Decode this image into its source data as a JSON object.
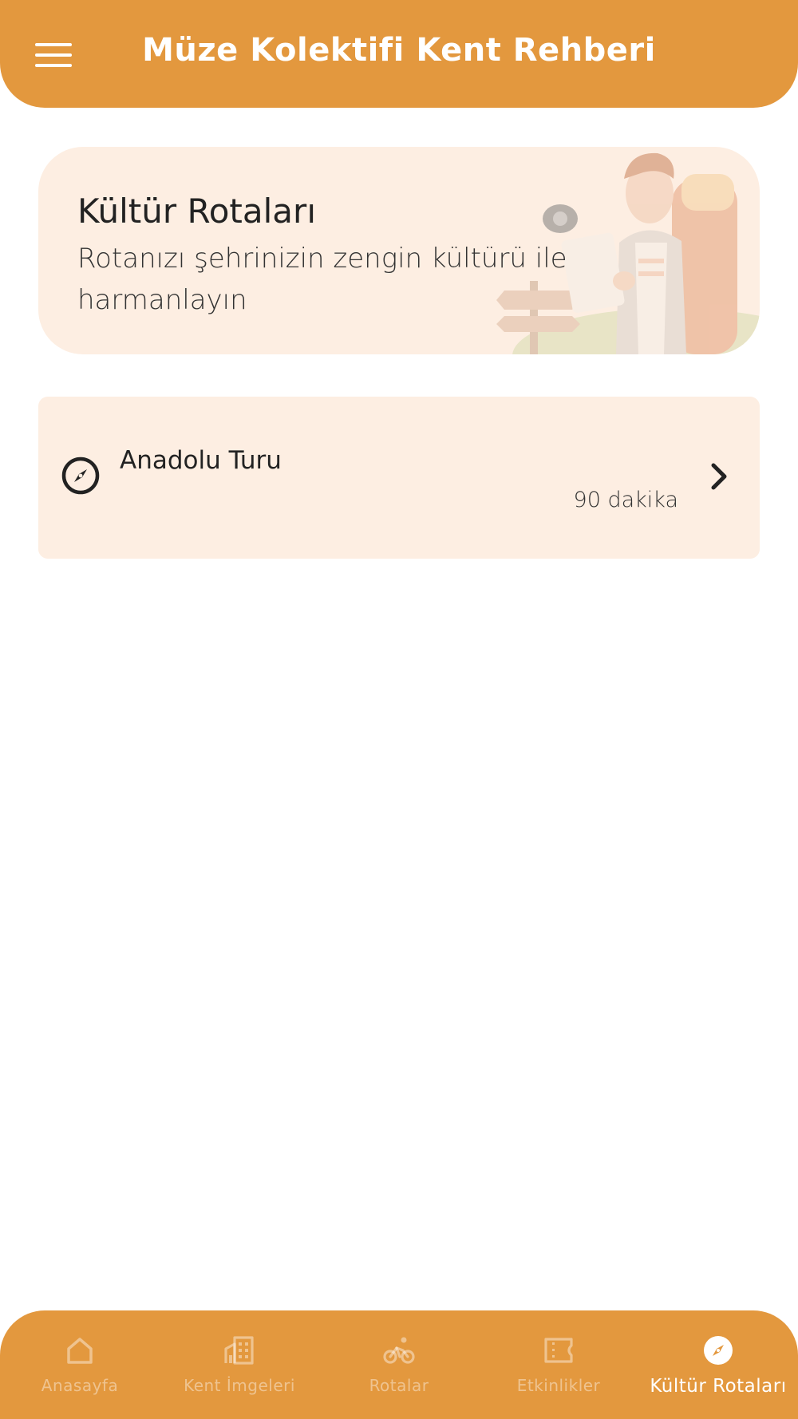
{
  "header": {
    "title": "Müze Kolektifi Kent Rehberi",
    "menu_icon": "hamburger-menu-icon"
  },
  "hero": {
    "title": "Kültür Rotaları",
    "subtitle": "Rotanızı şehrinizin zengin kültürü ile harmanlayın",
    "illustration": "traveler-with-backpack-illustration"
  },
  "routes": [
    {
      "name": "Anadolu Turu",
      "duration": "90 dakika",
      "icon": "compass-icon"
    }
  ],
  "bottom_nav": {
    "items": [
      {
        "label": "Anasayfa",
        "icon": "home-icon",
        "active": false
      },
      {
        "label": "Kent İmgeleri",
        "icon": "building-icon",
        "active": false
      },
      {
        "label": "Rotalar",
        "icon": "bicycle-icon",
        "active": false
      },
      {
        "label": "Etkinlikler",
        "icon": "ticket-icon",
        "active": false
      },
      {
        "label": "Kültür Rotaları",
        "icon": "compass-icon",
        "active": true
      }
    ]
  },
  "colors": {
    "primary": "#E3983E",
    "card_background": "#FDEEE2",
    "text": "#222222",
    "white": "#FFFFFF"
  }
}
